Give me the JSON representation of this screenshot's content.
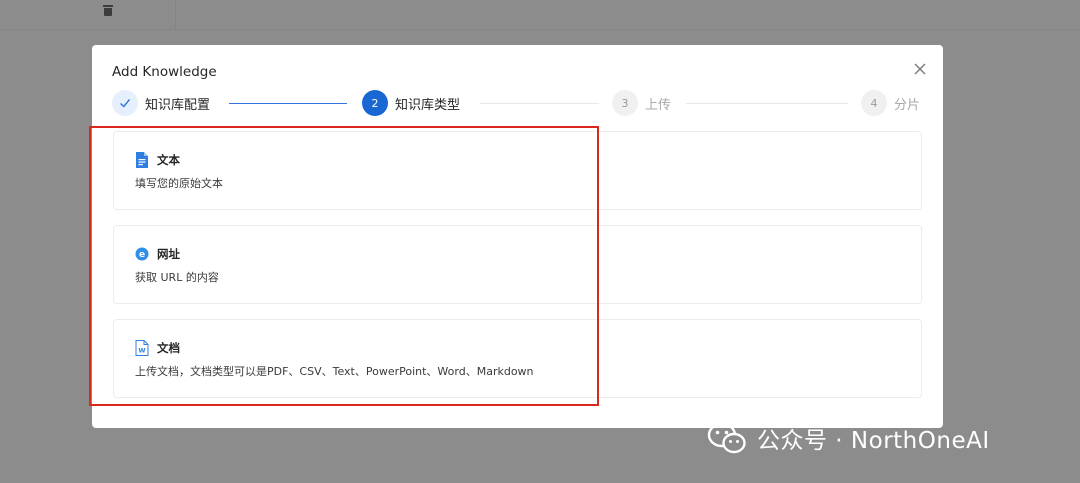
{
  "dialog": {
    "title": "Add Knowledge"
  },
  "steps": [
    {
      "number": "",
      "label": "知识库配置",
      "state": "done"
    },
    {
      "number": "2",
      "label": "知识库类型",
      "state": "active"
    },
    {
      "number": "3",
      "label": "上传",
      "state": "pending"
    },
    {
      "number": "4",
      "label": "分片",
      "state": "pending"
    }
  ],
  "options": [
    {
      "title": "文本",
      "description": "填写您的原始文本",
      "icon": "text-file-icon"
    },
    {
      "title": "网址",
      "description": "获取 URL 的内容",
      "icon": "web-link-icon"
    },
    {
      "title": "文档",
      "description": "上传文档，文档类型可以是PDF、CSV、Text、PowerPoint、Word、Markdown",
      "icon": "word-document-icon"
    }
  ],
  "watermark": {
    "text": "公众号 · NorthOneAI"
  },
  "colors": {
    "accent": "#1967d2",
    "annotation": "#d9291c",
    "overlay": "#8c8c8c"
  }
}
